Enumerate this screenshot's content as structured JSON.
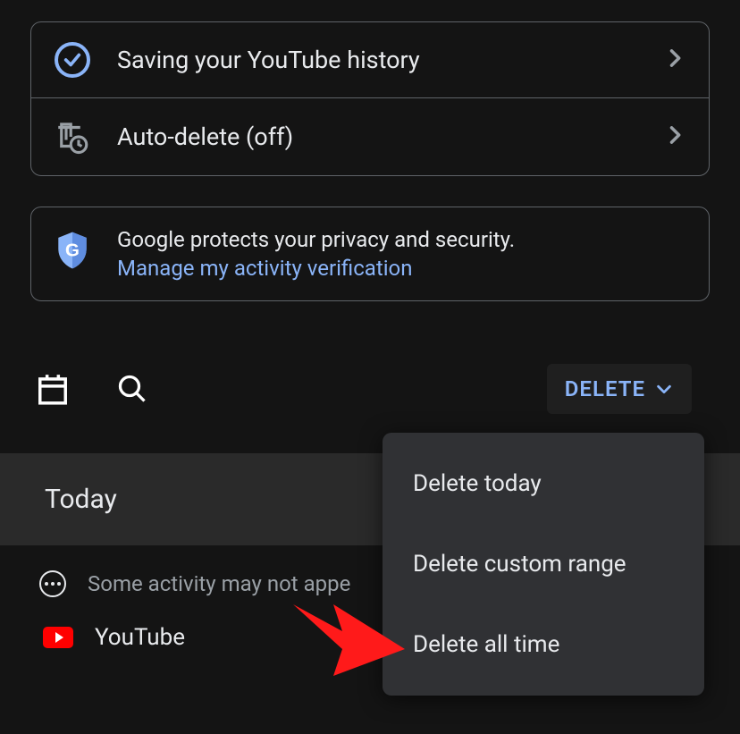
{
  "settings": {
    "items": [
      {
        "label": "Saving your YouTube history"
      },
      {
        "label": "Auto-delete (off)"
      }
    ]
  },
  "privacy": {
    "text": "Google protects your privacy and security.",
    "link": "Manage my activity verification"
  },
  "toolbar": {
    "delete_label": "DELETE"
  },
  "section": {
    "header": "Today"
  },
  "activity": {
    "notice": "Some activity may not appe",
    "service": "YouTube"
  },
  "dropdown": {
    "items": [
      {
        "label": "Delete today"
      },
      {
        "label": "Delete custom range"
      },
      {
        "label": "Delete all time"
      }
    ]
  }
}
